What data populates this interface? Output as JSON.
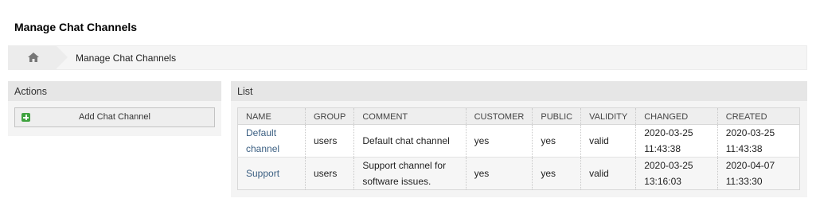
{
  "page": {
    "title": "Manage Chat Channels"
  },
  "breadcrumb": {
    "home_icon": "home-icon",
    "current": "Manage Chat Channels"
  },
  "actions": {
    "title": "Actions",
    "add_label": "Add Chat Channel",
    "add_icon": "plus-icon"
  },
  "list": {
    "title": "List",
    "columns": [
      "NAME",
      "GROUP",
      "COMMENT",
      "CUSTOMER",
      "PUBLIC",
      "VALIDITY",
      "CHANGED",
      "CREATED"
    ],
    "rows": [
      {
        "name": "Default channel",
        "group": "users",
        "comment": "Default chat channel",
        "customer": "yes",
        "public": "yes",
        "validity": "valid",
        "changed": "2020-03-25 11:43:38",
        "created": "2020-03-25 11:43:38"
      },
      {
        "name": "Support",
        "group": "users",
        "comment": "Support channel for software issues.",
        "customer": "yes",
        "public": "yes",
        "validity": "valid",
        "changed": "2020-03-25 13:16:03",
        "created": "2020-04-07 11:33:30"
      }
    ]
  },
  "colors": {
    "link": "#3b5f82",
    "add_icon": "#3fa33f",
    "panel_header": "#e6e6e6"
  }
}
